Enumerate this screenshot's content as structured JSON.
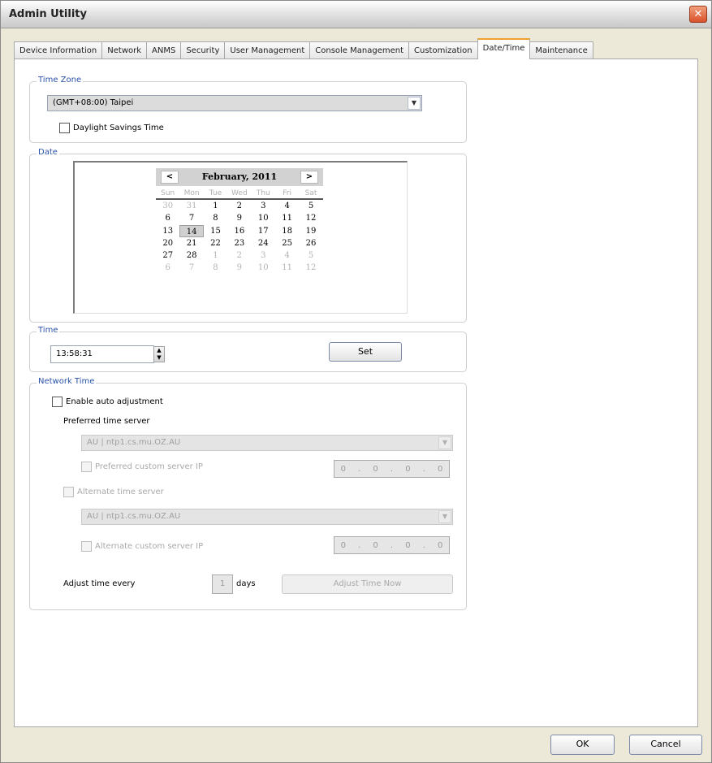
{
  "window": {
    "title": "Admin Utility"
  },
  "tabs": [
    {
      "label": "Device Information"
    },
    {
      "label": "Network"
    },
    {
      "label": "ANMS"
    },
    {
      "label": "Security"
    },
    {
      "label": "User Management"
    },
    {
      "label": "Console Management"
    },
    {
      "label": "Customization"
    },
    {
      "label": "Date/Time"
    },
    {
      "label": "Maintenance"
    }
  ],
  "active_tab": "Date/Time",
  "time_zone": {
    "legend": "Time Zone",
    "selected": "(GMT+08:00) Taipei",
    "daylight_label": "Daylight Savings Time",
    "daylight_checked": false
  },
  "date": {
    "legend": "Date",
    "month_label": "February, 2011",
    "prev_label": "<",
    "next_label": ">",
    "weekdays": [
      "Sun",
      "Mon",
      "Tue",
      "Wed",
      "Thu",
      "Fri",
      "Sat"
    ],
    "weeks": [
      [
        "30",
        "31",
        "1",
        "2",
        "3",
        "4",
        "5"
      ],
      [
        "6",
        "7",
        "8",
        "9",
        "10",
        "11",
        "12"
      ],
      [
        "13",
        "14",
        "15",
        "16",
        "17",
        "18",
        "19"
      ],
      [
        "20",
        "21",
        "22",
        "23",
        "24",
        "25",
        "26"
      ],
      [
        "27",
        "28",
        "1",
        "2",
        "3",
        "4",
        "5"
      ],
      [
        "6",
        "7",
        "8",
        "9",
        "10",
        "11",
        "12"
      ]
    ],
    "selected_day": "14"
  },
  "time": {
    "legend": "Time",
    "value": "13:58:31",
    "set_label": "Set"
  },
  "network_time": {
    "legend": "Network Time",
    "enable_label": "Enable auto adjustment",
    "enable_checked": false,
    "preferred_label": "Preferred time server",
    "preferred_server": "AU | ntp1.cs.mu.OZ.AU",
    "preferred_custom_label": "Preferred custom server IP",
    "preferred_ip": [
      "0",
      "0",
      "0",
      "0"
    ],
    "alternate_label": "Alternate time server",
    "alternate_server": "AU | ntp1.cs.mu.OZ.AU",
    "alternate_custom_label": "Alternate custom server IP",
    "alternate_ip": [
      "0",
      "0",
      "0",
      "0"
    ],
    "adjust_every_label": "Adjust time every",
    "days_value": "1",
    "days_label": "days",
    "adjust_now_label": "Adjust Time Now"
  },
  "footer": {
    "ok_label": "OK",
    "cancel_label": "Cancel"
  }
}
